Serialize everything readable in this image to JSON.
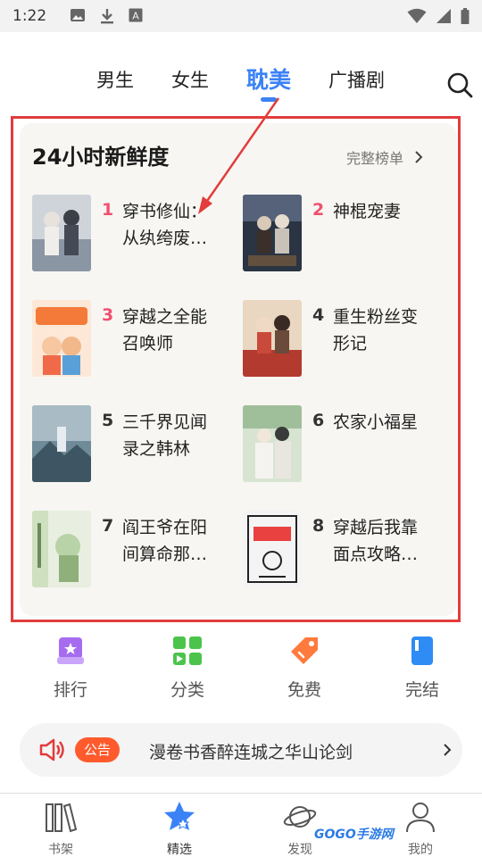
{
  "status_bar": {
    "time": "1:22"
  },
  "top_tabs": [
    {
      "label": "男生",
      "active": false
    },
    {
      "label": "女生",
      "active": false
    },
    {
      "label": "耽美",
      "active": true
    },
    {
      "label": "广播剧",
      "active": false
    }
  ],
  "ranking": {
    "title": "24小时新鲜度",
    "more_label": "完整榜单",
    "books": [
      {
        "rank": "1",
        "title": "穿书修仙：从纨绔废…",
        "hot": true
      },
      {
        "rank": "2",
        "title": "神棍宠妻",
        "hot": true
      },
      {
        "rank": "3",
        "title": "穿越之全能召唤师",
        "hot": true
      },
      {
        "rank": "4",
        "title": "重生粉丝变形记",
        "hot": false
      },
      {
        "rank": "5",
        "title": "三千界见闻录之韩林",
        "hot": false
      },
      {
        "rank": "6",
        "title": "农家小福星",
        "hot": false
      },
      {
        "rank": "7",
        "title": "阎王爷在阳间算命那…",
        "hot": false
      },
      {
        "rank": "8",
        "title": "穿越后我靠面点攻略…",
        "hot": false
      }
    ]
  },
  "quick_entries": [
    {
      "label": "排行",
      "color": "#a66cf0"
    },
    {
      "label": "分类",
      "color": "#4cc44c"
    },
    {
      "label": "免费",
      "color": "#ff7a3d"
    },
    {
      "label": "完结",
      "color": "#2f8cf5"
    }
  ],
  "notice": {
    "badge": "公告",
    "text": "漫卷书香醉连城之华山论剑"
  },
  "bottom_nav": [
    {
      "label": "书架",
      "active": false
    },
    {
      "label": "精选",
      "active": true
    },
    {
      "label": "发现",
      "active": false
    },
    {
      "label": "我的",
      "active": false
    }
  ],
  "watermark": "GOGO手游网",
  "colors": {
    "accent": "#3b82f6",
    "hot_rank": "#f0506e",
    "highlight": "#e23c3c"
  }
}
